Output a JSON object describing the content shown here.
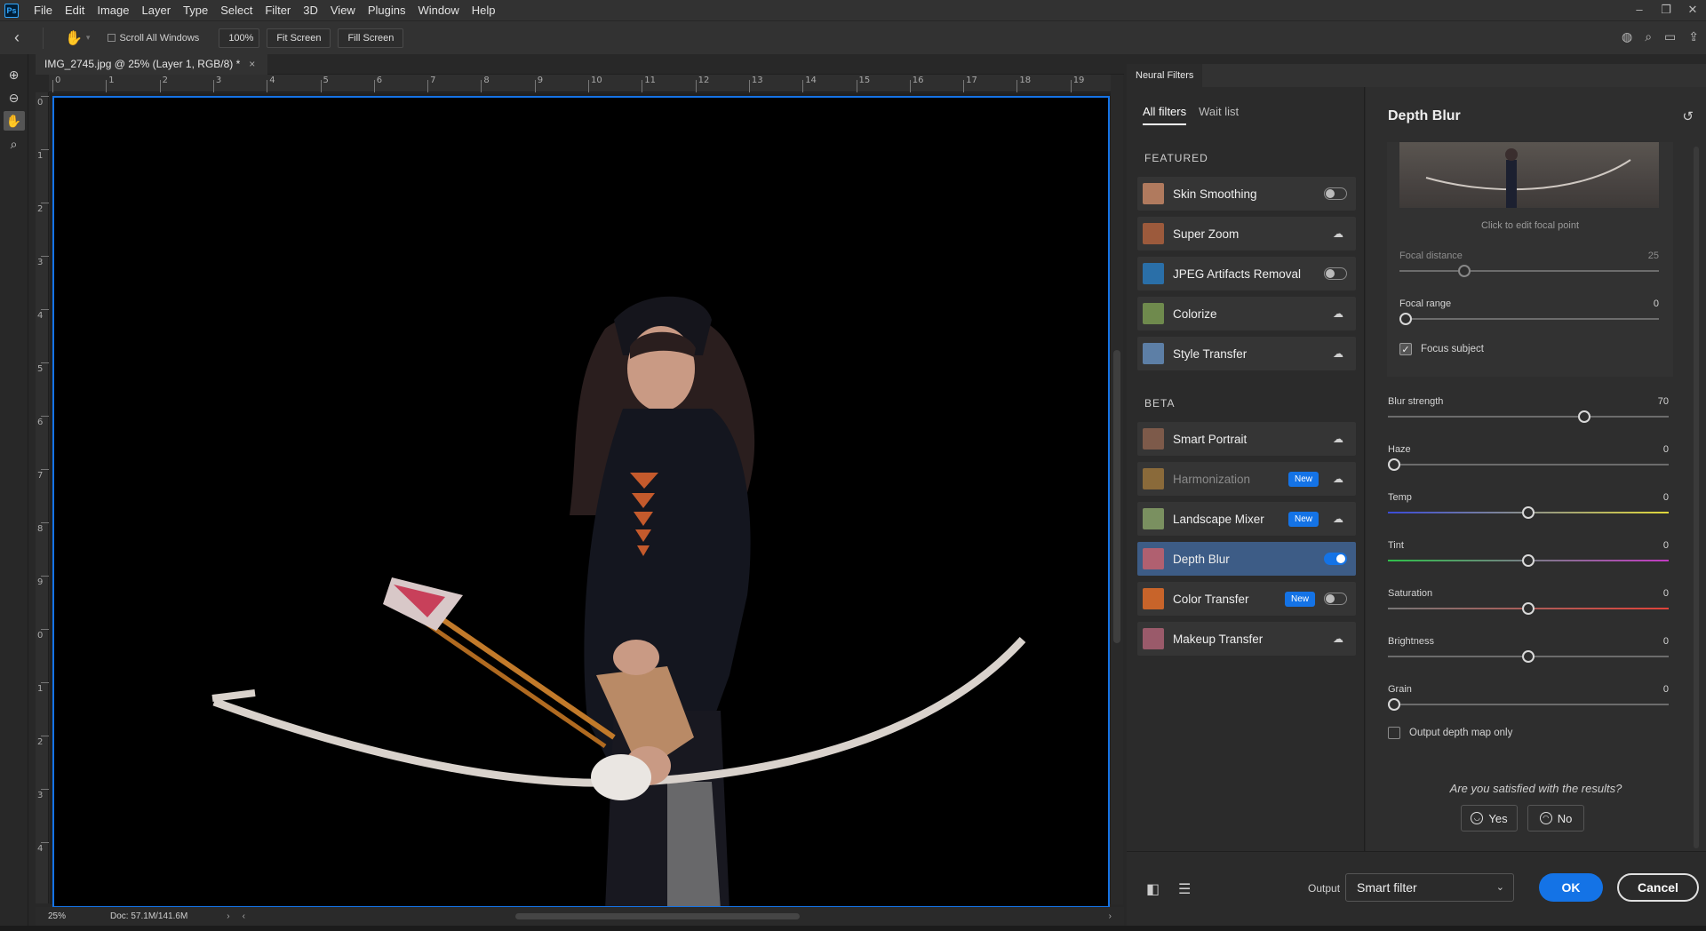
{
  "menubar": {
    "logo": "Ps",
    "items": [
      "File",
      "Edit",
      "Image",
      "Layer",
      "Type",
      "Select",
      "Filter",
      "3D",
      "View",
      "Plugins",
      "Window",
      "Help"
    ]
  },
  "options_bar": {
    "scroll_all_windows": "Scroll All Windows",
    "zoom": "100%",
    "fit_screen": "Fit Screen",
    "fill_screen": "Fill Screen"
  },
  "document": {
    "tab_title": "IMG_2745.jpg @ 25% (Layer 1, RGB/8) *",
    "close": "×",
    "ruler_top": [
      "0",
      "1",
      "2",
      "3",
      "4",
      "5",
      "6",
      "7",
      "8",
      "9",
      "10",
      "11",
      "12",
      "13",
      "14",
      "15",
      "16",
      "17",
      "18",
      "19"
    ],
    "ruler_left": [
      "0",
      "1",
      "2",
      "3",
      "4",
      "5",
      "6",
      "7",
      "8",
      "9",
      "0",
      "1",
      "2",
      "3",
      "4"
    ],
    "zoom_status": "25%",
    "doc_status": "Doc: 57.1M/141.6M"
  },
  "neural_filters": {
    "panel_title": "Neural Filters",
    "tabs": [
      "All filters",
      "Wait list"
    ],
    "featured_label": "FEATURED",
    "beta_label": "BETA",
    "featured": [
      {
        "name": "Skin Smoothing",
        "control": "toggle-off",
        "thumb": "#b07a5e"
      },
      {
        "name": "Super Zoom",
        "control": "cloud",
        "thumb": "#9c5a3c"
      },
      {
        "name": "JPEG Artifacts Removal",
        "control": "toggle-off",
        "thumb": "#2a6fa8"
      },
      {
        "name": "Colorize",
        "control": "cloud",
        "thumb": "#6f8a4d"
      },
      {
        "name": "Style Transfer",
        "control": "cloud",
        "thumb": "#5d7fa6"
      }
    ],
    "beta": [
      {
        "name": "Smart Portrait",
        "control": "cloud",
        "thumb": "#7d5a4a"
      },
      {
        "name": "Harmonization",
        "control": "cloud",
        "badge": "New",
        "dim": true,
        "thumb": "#8a6a3a"
      },
      {
        "name": "Landscape Mixer",
        "control": "cloud",
        "badge": "New",
        "thumb": "#7a9060"
      },
      {
        "name": "Depth Blur",
        "control": "toggle-on",
        "selected": true,
        "thumb": "#b06070"
      },
      {
        "name": "Color Transfer",
        "control": "toggle-off",
        "badge": "New",
        "thumb": "#c8642a"
      },
      {
        "name": "Makeup Transfer",
        "control": "cloud",
        "thumb": "#9a5a6a"
      }
    ],
    "settings": {
      "title": "Depth Blur",
      "focal_caption": "Click to edit focal point",
      "focal_distance": {
        "label": "Focal distance",
        "value": "25",
        "level": 0.25
      },
      "focal_range": {
        "label": "Focal range",
        "value": "0",
        "level": 0.0
      },
      "focus_subject": "Focus subject",
      "sliders": [
        {
          "label": "Blur strength",
          "value": "70",
          "level": 0.7
        },
        {
          "label": "Haze",
          "value": "0",
          "level": 0.0
        },
        {
          "label": "Temp",
          "value": "0",
          "level": 0.5
        },
        {
          "label": "Tint",
          "value": "0",
          "level": 0.5
        },
        {
          "label": "Saturation",
          "value": "0",
          "level": 0.5
        },
        {
          "label": "Brightness",
          "value": "0",
          "level": 0.5
        },
        {
          "label": "Grain",
          "value": "0",
          "level": 0.0
        }
      ],
      "output_depth_map": "Output depth map only",
      "satisfied_question": "Are you satisfied with the results?",
      "yes": "Yes",
      "no": "No"
    },
    "footer": {
      "output_label": "Output",
      "output_value": "Smart filter",
      "ok": "OK",
      "cancel": "Cancel"
    }
  },
  "colors": {
    "accent": "#1473e6",
    "canvas_border": "#1573e6",
    "selected_row": "#3d5c86"
  }
}
